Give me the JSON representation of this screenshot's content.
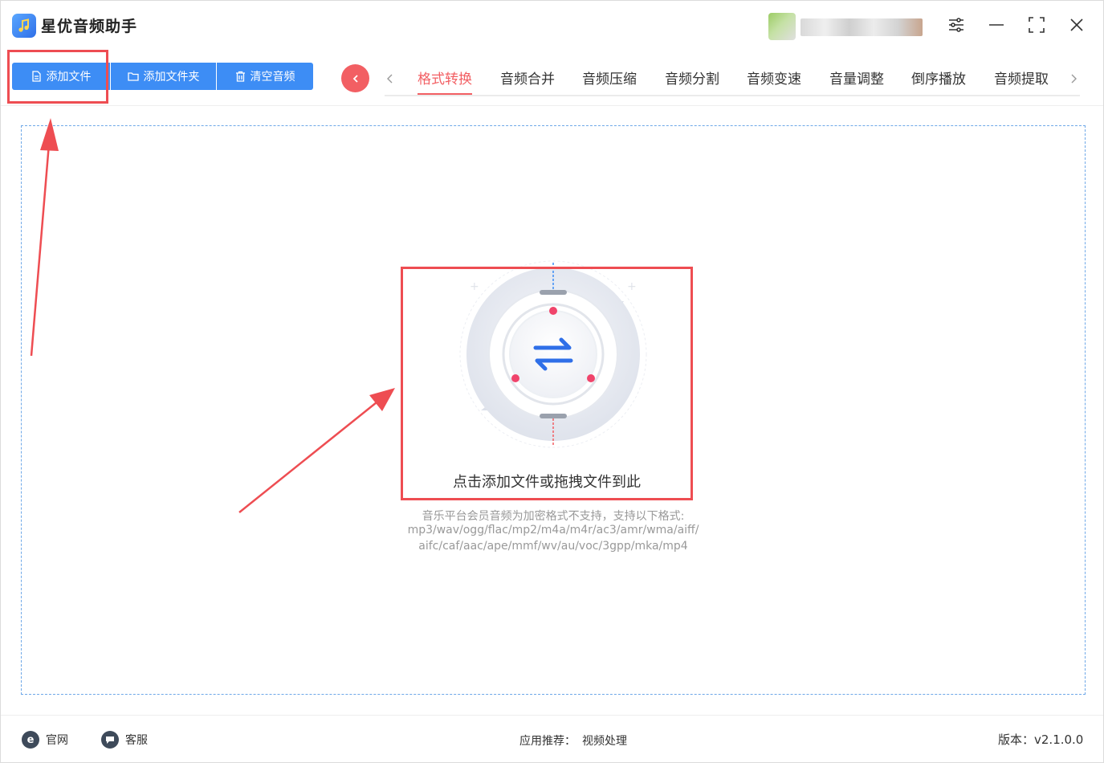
{
  "app": {
    "title": "星优音频助手",
    "accent_color": "#3d8df5",
    "highlight_color": "#f25f63"
  },
  "titlebar": {
    "icons": [
      "music-note-icon",
      "settings-sliders-icon",
      "minimize-icon",
      "maximize-icon",
      "close-icon"
    ]
  },
  "toolbar": {
    "add_file": "添加文件",
    "add_folder": "添加文件夹",
    "clear_audio": "清空音频"
  },
  "tabs": [
    {
      "label": "格式转换",
      "active": true
    },
    {
      "label": "音频合并",
      "active": false
    },
    {
      "label": "音频压缩",
      "active": false
    },
    {
      "label": "音频分割",
      "active": false
    },
    {
      "label": "音频变速",
      "active": false
    },
    {
      "label": "音量调整",
      "active": false
    },
    {
      "label": "倒序播放",
      "active": false
    },
    {
      "label": "音频提取",
      "active": false
    }
  ],
  "dropzone": {
    "prompt": "点击添加文件或拖拽文件到此",
    "format_lines": [
      "音乐平台会员音频为加密格式不支持，支持以下格式:",
      "mp3/wav/ogg/flac/mp2/m4a/m4r/ac3/amr/wma/aiff/",
      "aifc/caf/aac/ape/mmf/wv/au/voc/3gpp/mka/mp4"
    ]
  },
  "footer": {
    "website": "官网",
    "support": "客服",
    "recommend_label": "应用推荐：",
    "recommend_link": "视频处理",
    "version": "版本：v2.1.0.0"
  }
}
